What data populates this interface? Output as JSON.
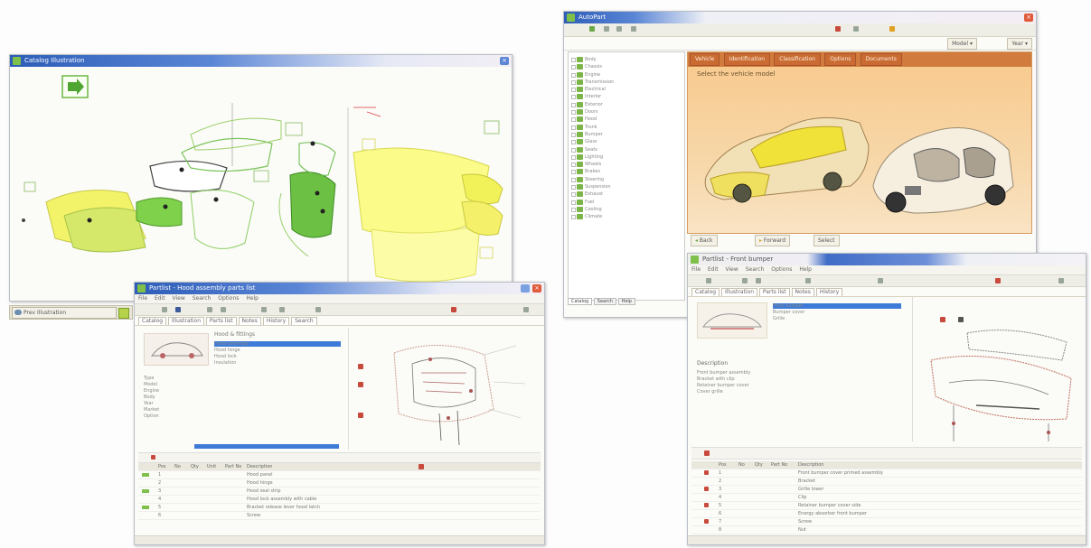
{
  "win1": {
    "title": "Catalog Illustration"
  },
  "taskbar": {
    "item1": "Prev Illustration"
  },
  "win2": {
    "title": "Partlist - Hood assembly parts list",
    "menu": [
      "File",
      "Edit",
      "View",
      "Search",
      "Options",
      "Help"
    ],
    "tabs": [
      "Catalog",
      "Illustration",
      "Parts list",
      "Notes",
      "History",
      "Search"
    ],
    "info_header": "Hood & fittings",
    "variants": [
      "Hood assembly",
      "Hood hinge",
      "Hood lock",
      "Insulation"
    ],
    "details": [
      "Type",
      "Model",
      "Engine",
      "Body",
      "Year",
      "Market",
      "Option"
    ],
    "columns": [
      "Pos",
      "No",
      "Qty",
      "Unit",
      "Part No",
      "Description"
    ],
    "rows": [
      {
        "pos": "1",
        "desc": "Hood panel"
      },
      {
        "pos": "2",
        "desc": "Hood hinge"
      },
      {
        "pos": "3",
        "desc": "Hood seal strip"
      },
      {
        "pos": "4",
        "desc": "Hood lock assembly with cable"
      },
      {
        "pos": "5",
        "desc": "Bracket release lever hood latch"
      },
      {
        "pos": "6",
        "desc": "Screw"
      }
    ]
  },
  "win3": {
    "title": "AutoPart",
    "tree": [
      "Body",
      "Chassis",
      "Engine",
      "Transmission",
      "Electrical",
      "Interior",
      "Exterior",
      "Doors",
      "Hood",
      "Trunk",
      "Bumper",
      "Glass",
      "Seats",
      "Lighting",
      "Wheels",
      "Brakes",
      "Steering",
      "Suspension",
      "Exhaust",
      "Fuel",
      "Cooling",
      "Climate"
    ],
    "tree_footer": [
      "Catalog",
      "Search",
      "Help"
    ],
    "detail_tabs": [
      "Vehicle",
      "Identification",
      "Classification",
      "Options",
      "Documents"
    ],
    "vehicle_caption": "Select the vehicle model",
    "bottom_buttons": [
      "Back",
      "Forward",
      "Select"
    ],
    "model_select": "Model",
    "year_select": "Year"
  },
  "win4": {
    "title": "Partlist - Front bumper",
    "menu": [
      "File",
      "Edit",
      "View",
      "Search",
      "Options",
      "Help"
    ],
    "tabs": [
      "Catalog",
      "Illustration",
      "Parts list",
      "Notes",
      "History"
    ],
    "variants": [
      "Front bumper",
      "Bumper cover",
      "Grille"
    ],
    "desc_header": "Description",
    "desc_lines": [
      "Front bumper assembly",
      "Bracket with clip",
      "Retainer bumper cover",
      "Cover grille"
    ],
    "columns": [
      "Pos",
      "No",
      "Qty",
      "Part No",
      "Description"
    ],
    "rows": [
      {
        "pos": "1",
        "desc": "Front bumper cover primed assembly"
      },
      {
        "pos": "2",
        "desc": "Bracket"
      },
      {
        "pos": "3",
        "desc": "Grille lower"
      },
      {
        "pos": "4",
        "desc": "Clip"
      },
      {
        "pos": "5",
        "desc": "Retainer bumper cover side"
      },
      {
        "pos": "6",
        "desc": "Energy absorber front bumper"
      },
      {
        "pos": "7",
        "desc": "Screw"
      },
      {
        "pos": "8",
        "desc": "Nut"
      }
    ]
  }
}
